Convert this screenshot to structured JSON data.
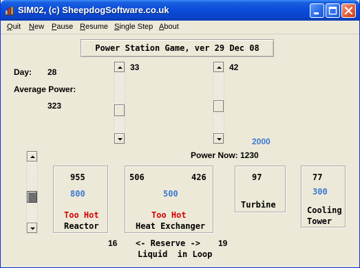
{
  "window": {
    "title": "SIM02, (c) SheepdogSoftware.co.uk"
  },
  "menu": {
    "quit": {
      "u": "Q",
      "rest": "uit"
    },
    "new": {
      "u": "N",
      "rest": "ew"
    },
    "pause": {
      "u": "P",
      "rest": "ause"
    },
    "resume": {
      "u": "R",
      "rest": "esume"
    },
    "single_step": {
      "u": "S",
      "rest": "ingle Step"
    },
    "about": {
      "u": "A",
      "rest": "bout"
    }
  },
  "header_button": "Power Station Game, ver 29 Dec 08",
  "stats": {
    "day_label": "Day:",
    "day_value": "28",
    "avg_label": "Average Power:",
    "avg_value": "323"
  },
  "scrollbars": {
    "left_value": "33",
    "right_value": "42",
    "target_value": "2000"
  },
  "power_now": "Power Now: 1230",
  "reactor": {
    "temp": "955",
    "setting": "800",
    "status": "Too Hot",
    "name": "Reactor"
  },
  "heat_exchanger": {
    "left_temp": "506",
    "right_temp": "426",
    "setting": "500",
    "status": "Too Hot",
    "name": "Heat Exchanger"
  },
  "turbine": {
    "value": "97",
    "name": "Turbine"
  },
  "cooling_tower": {
    "value": "77",
    "setting": "300",
    "name_line1": "Cooling",
    "name_line2": "Tower"
  },
  "reserve": {
    "left": "16",
    "label": "<- Reserve ->",
    "right": "19",
    "footer": "Liquid  in Loop"
  },
  "colors": {
    "titlebar": "#0a4bd8",
    "face": "#ece9d8",
    "setpoint_blue": "#3a78cf",
    "warning_red": "#d40000"
  }
}
